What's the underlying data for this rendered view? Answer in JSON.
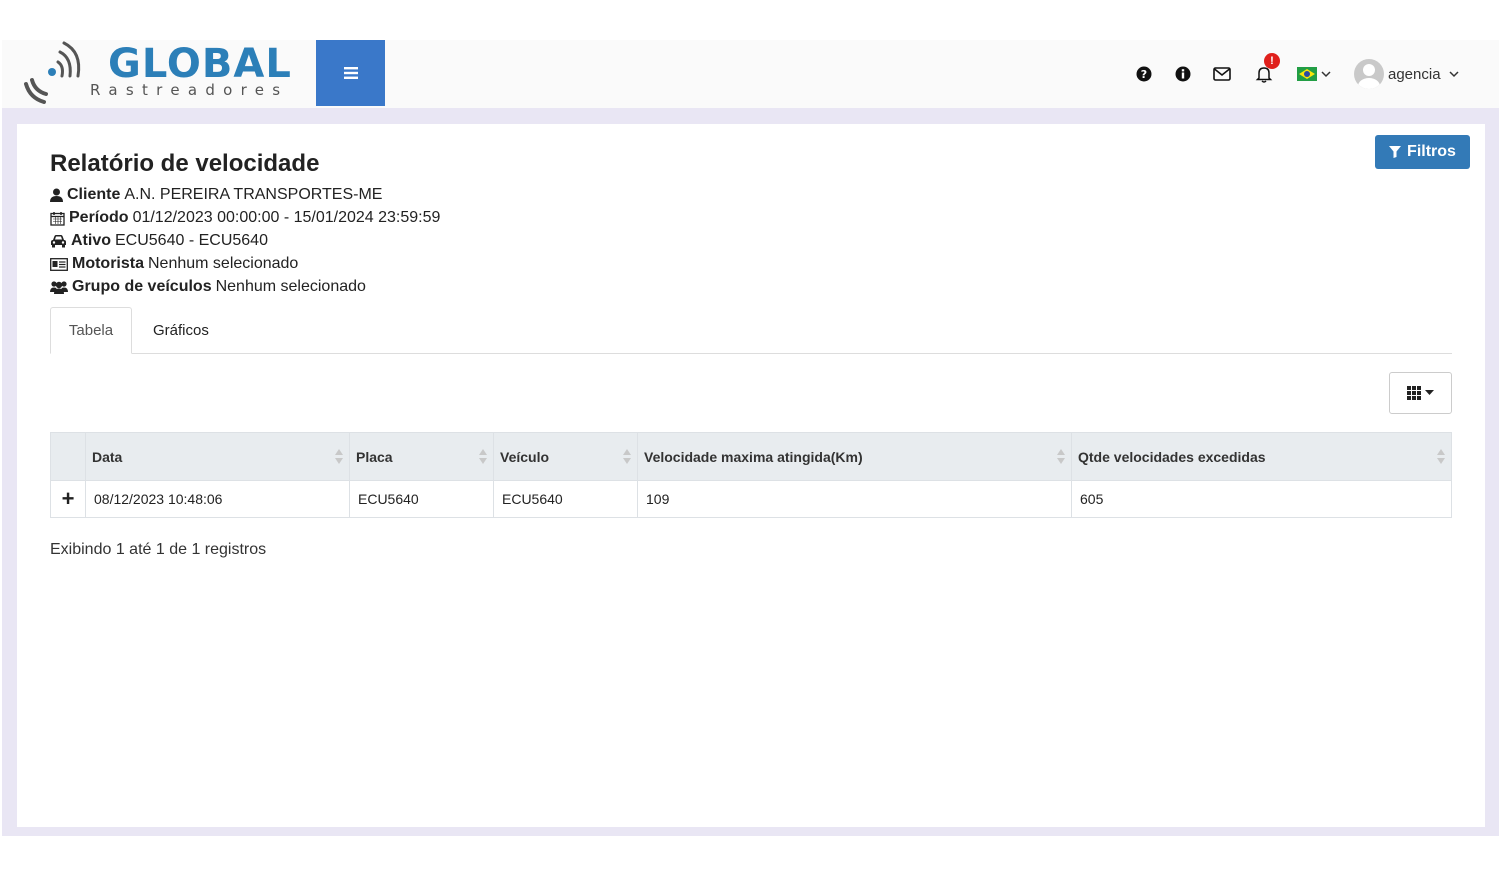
{
  "brand": {
    "name": "GLOBAL",
    "tagline": "Rastreadores"
  },
  "header": {
    "menu_icon": "bars-icon",
    "icons": [
      "question-circle-icon",
      "info-circle-icon",
      "envelope-icon",
      "bell-icon",
      "brazil-flag-icon"
    ],
    "notification_badge": "!",
    "user": "agencia"
  },
  "report": {
    "title": "Relatório de velocidade",
    "filters_button": "Filtros",
    "info": {
      "cliente_label": "Cliente",
      "cliente_value": "A.N. PEREIRA TRANSPORTES-ME",
      "periodo_label": "Período",
      "periodo_value": "01/12/2023 00:00:00 - 15/01/2024 23:59:59",
      "ativo_label": "Ativo",
      "ativo_value": "ECU5640 - ECU5640",
      "motorista_label": "Motorista",
      "motorista_value": "Nenhum selecionado",
      "grupo_label": "Grupo de veículos",
      "grupo_value": "Nenhum selecionado"
    },
    "tabs": [
      {
        "label": "Tabela"
      },
      {
        "label": "Gráficos"
      }
    ],
    "table": {
      "columns": [
        "Data",
        "Placa",
        "Veículo",
        "Velocidade maxima atingida(Km)",
        "Qtde velocidades excedidas"
      ],
      "rows": [
        {
          "expand": "+",
          "data": "08/12/2023 10:48:06",
          "placa": "ECU5640",
          "veiculo": "ECU5640",
          "velocidade": "109",
          "qtde": "605"
        }
      ]
    },
    "records_text": "Exibindo 1 até 1 de 1 registros"
  },
  "colors": {
    "primary": "#337ab7",
    "menu": "#3a78c9",
    "logo": "#2c7fb8",
    "frame": "#e9e6f4",
    "badge": "#e0201c"
  }
}
